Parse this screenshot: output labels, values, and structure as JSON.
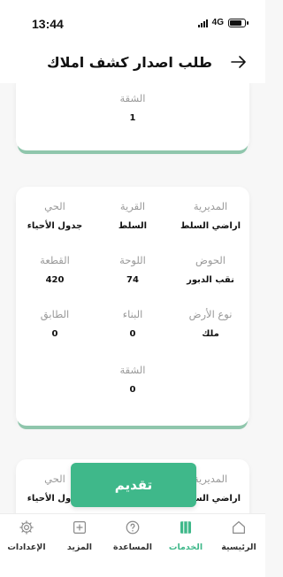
{
  "status_bar": {
    "time": "13:44",
    "network": "4G",
    "battery_level": 0.8
  },
  "header": {
    "title": "طلب اصدار كشف املاك",
    "back_icon": "arrow-right-icon"
  },
  "cards": [
    {
      "fields": [
        {
          "label": "الشقة",
          "value": "1"
        }
      ]
    },
    {
      "fields": [
        {
          "label": "المديرية",
          "value": "اراضي السلط"
        },
        {
          "label": "القرية",
          "value": "السلط"
        },
        {
          "label": "الحي",
          "value": "جدول الأحياء"
        },
        {
          "label": "الحوض",
          "value": "نقب الدبور"
        },
        {
          "label": "اللوحة",
          "value": "74"
        },
        {
          "label": "القطعة",
          "value": "420"
        },
        {
          "label": "نوع الأرض",
          "value": "ملك"
        },
        {
          "label": "البناء",
          "value": "0"
        },
        {
          "label": "الطابق",
          "value": "0"
        },
        {
          "label": "الشقة",
          "value": "0"
        }
      ]
    },
    {
      "fields": [
        {
          "label": "المديرية",
          "value": "اراضي السلط"
        },
        {
          "label": "الحي",
          "value": "جدول الأحياء"
        }
      ]
    }
  ],
  "submit": {
    "label": "تقديم"
  },
  "bottom_nav": {
    "accent_color": "#3fb88a",
    "items": [
      {
        "label": "الإعدادات",
        "icon": "gear-icon",
        "active": false
      },
      {
        "label": "المزيد",
        "icon": "plus-square-icon",
        "active": false
      },
      {
        "label": "المساعدة",
        "icon": "help-circle-icon",
        "active": false
      },
      {
        "label": "الخدمات",
        "icon": "services-icon",
        "active": true
      },
      {
        "label": "الرئيسية",
        "icon": "home-icon",
        "active": false
      }
    ]
  }
}
